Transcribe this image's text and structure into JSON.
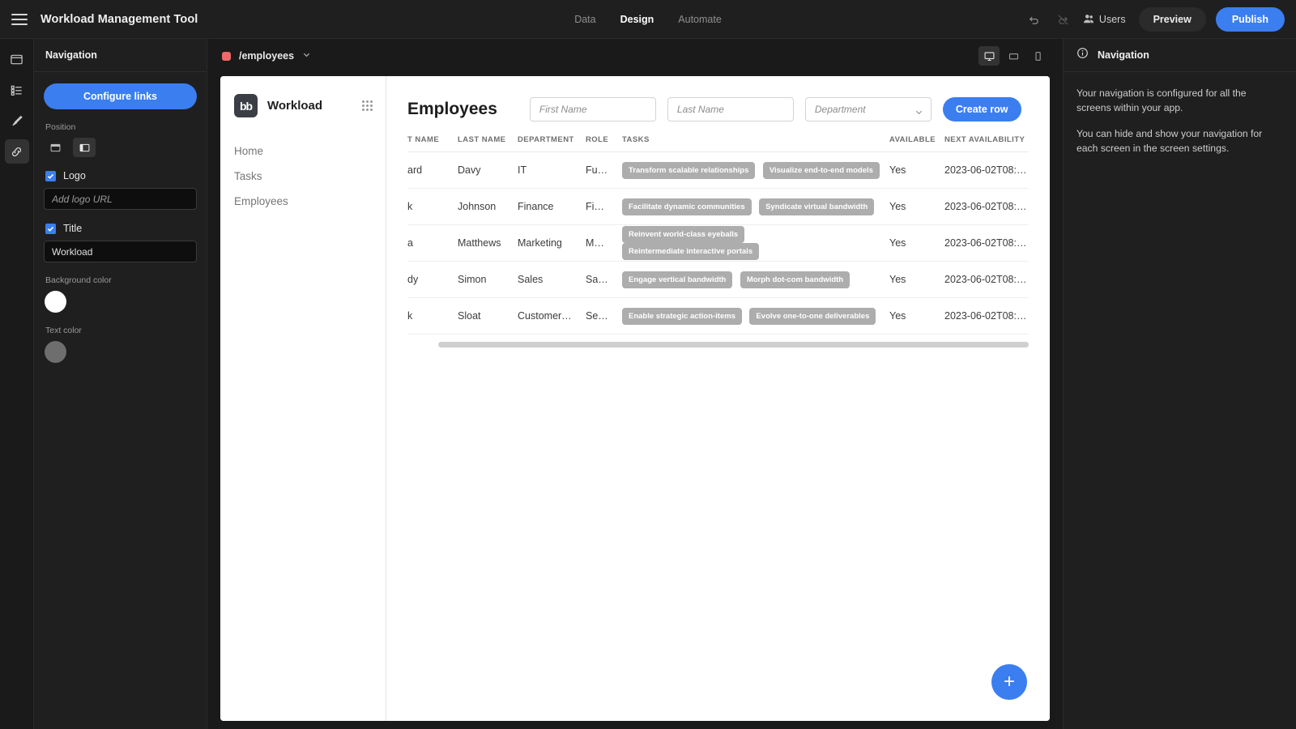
{
  "topbar": {
    "menu_icon": "hamburger-icon",
    "app_title": "Workload Management Tool",
    "tabs": [
      {
        "label": "Data",
        "active": false
      },
      {
        "label": "Design",
        "active": true
      },
      {
        "label": "Automate",
        "active": false
      }
    ],
    "undo_icon": "undo-icon",
    "redo_icon": "redo-disabled-icon",
    "users_icon": "users-icon",
    "users_label": "Users",
    "preview_label": "Preview",
    "publish_label": "Publish",
    "publish_color": "#3a7ef0"
  },
  "rail": {
    "items": [
      {
        "icon": "screen-icon",
        "active": false
      },
      {
        "icon": "components-list-icon",
        "active": false
      },
      {
        "icon": "theme-brush-icon",
        "active": false
      },
      {
        "icon": "navigation-link-icon",
        "active": true
      }
    ]
  },
  "left_panel": {
    "title": "Navigation",
    "configure_label": "Configure links",
    "position_label": "Position",
    "position_options": [
      {
        "icon": "nav-top-icon",
        "selected": false
      },
      {
        "icon": "nav-left-icon",
        "selected": true
      }
    ],
    "logo_label": "Logo",
    "logo_checked": true,
    "logo_placeholder": "Add logo URL",
    "logo_value": "",
    "title_label": "Title",
    "title_checked": true,
    "title_value": "Workload",
    "background_color_label": "Background color",
    "background_color": "#ffffff",
    "text_color_label": "Text color",
    "text_color": "#6e6e6e"
  },
  "canvas": {
    "screen_dot_color": "#ee6a6a",
    "screen_name": "/employees",
    "screen_chevron": "chevron-down-icon",
    "devices": [
      {
        "icon": "desktop-icon",
        "active": true
      },
      {
        "icon": "tablet-icon",
        "active": false
      },
      {
        "icon": "mobile-icon",
        "active": false
      }
    ]
  },
  "app_preview": {
    "logo_text": "bb",
    "nav_title": "Workload",
    "grid_icon": "grid-dots-icon",
    "nav_links": [
      {
        "label": "Home"
      },
      {
        "label": "Tasks"
      },
      {
        "label": "Employees"
      }
    ],
    "page_title": "Employees",
    "filters": {
      "first_name_placeholder": "First Name",
      "first_name_value": "",
      "last_name_placeholder": "Last Name",
      "last_name_value": "",
      "department_placeholder": "Department",
      "department_value": "",
      "department_chevron": "chevron-down-icon"
    },
    "create_row_label": "Create row",
    "table": {
      "columns": [
        "T NAME",
        "LAST NAME",
        "DEPARTMENT",
        "ROLE",
        "TASKS",
        "AVAILABLE",
        "NEXT AVAILABILITY"
      ],
      "rows": [
        {
          "first_name": "ard",
          "last_name": "Davy",
          "department": "IT",
          "role": "Fu…",
          "tasks": [
            "Transform scalable relationships",
            "Visualize end-to-end models"
          ],
          "available": "Yes",
          "next_availability": "2023-06-02T08:…"
        },
        {
          "first_name": "k",
          "last_name": "Johnson",
          "department": "Finance",
          "role": "Fi…",
          "tasks": [
            "Facilitate dynamic communities",
            "Syndicate virtual bandwidth"
          ],
          "available": "Yes",
          "next_availability": "2023-06-02T08:…"
        },
        {
          "first_name": "a",
          "last_name": "Matthews",
          "department": "Marketing",
          "role": "M…",
          "tasks": [
            "Reinvent world-class eyeballs",
            "Reintermediate interactive portals"
          ],
          "available": "Yes",
          "next_availability": "2023-06-02T08:…"
        },
        {
          "first_name": "dy",
          "last_name": "Simon",
          "department": "Sales",
          "role": "Sa…",
          "tasks": [
            "Engage vertical bandwidth",
            "Morph dot-com bandwidth"
          ],
          "available": "Yes",
          "next_availability": "2023-06-02T08:…"
        },
        {
          "first_name": "k",
          "last_name": "Sloat",
          "department": "Customer…",
          "role": "Se…",
          "tasks": [
            "Enable strategic action-items",
            "Evolve one-to-one deliverables"
          ],
          "available": "Yes",
          "next_availability": "2023-06-02T08:…"
        }
      ]
    },
    "fab_label": "+"
  },
  "right_panel": {
    "info_icon": "info-icon",
    "title": "Navigation",
    "paragraph_1": "Your navigation is configured for all the screens within your app.",
    "paragraph_2": "You can hide and show your navigation for each screen in the screen settings."
  }
}
